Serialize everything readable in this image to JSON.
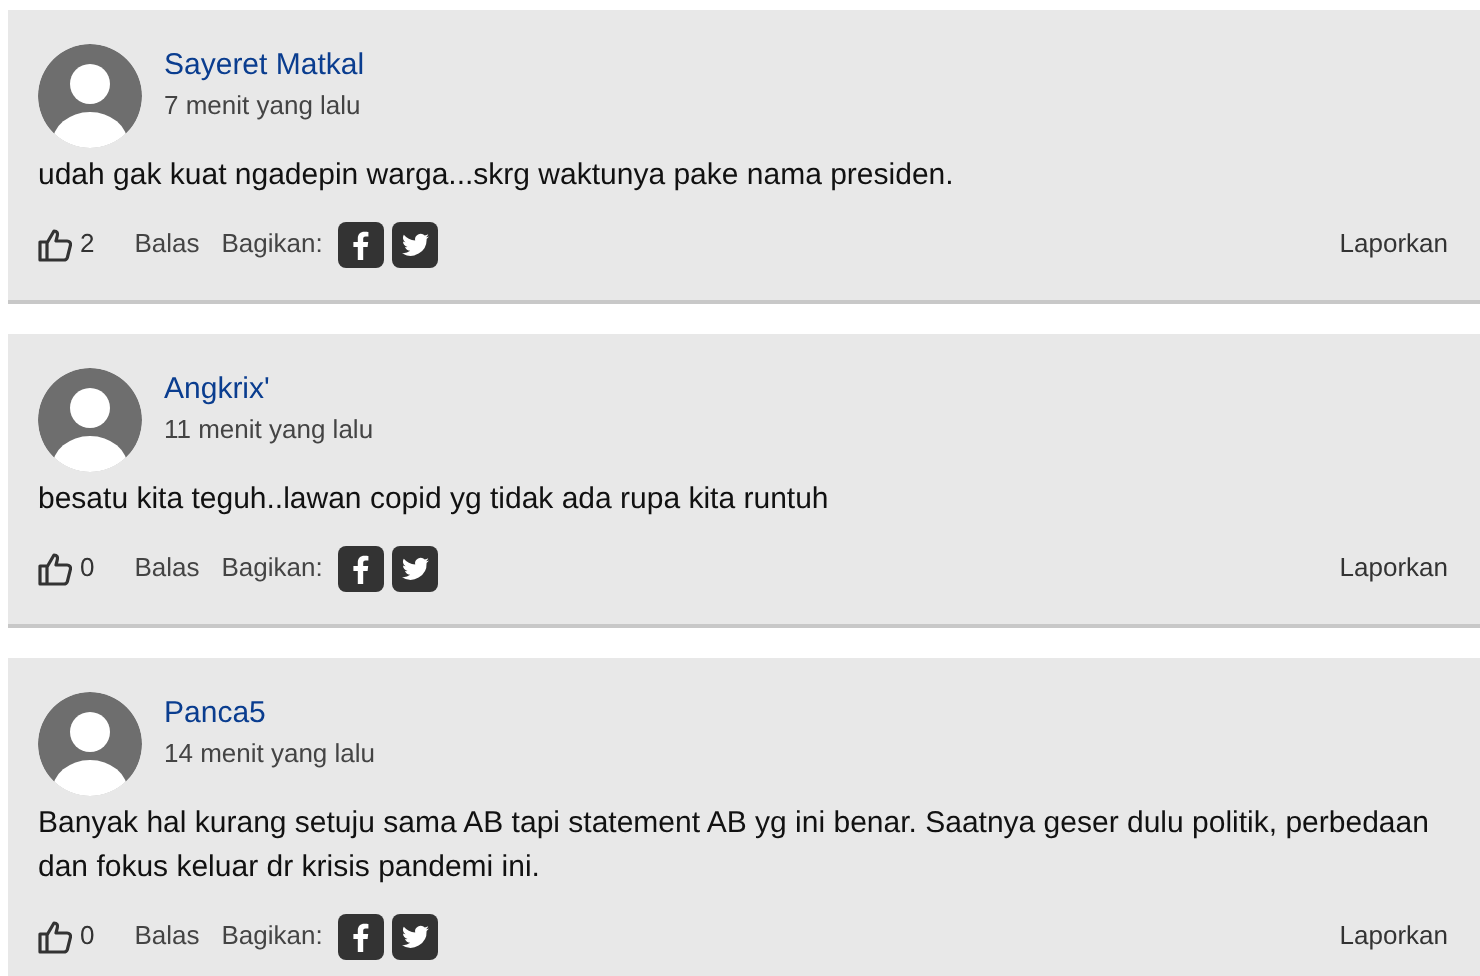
{
  "comments": [
    {
      "author": "Sayeret Matkal",
      "time": "7 menit yang lalu",
      "text": "udah gak kuat ngadepin warga...skrg waktunya pake nama presiden.",
      "likes": "2",
      "reply": "Balas",
      "share_label": "Bagikan:",
      "report": "Laporkan"
    },
    {
      "author": "Angkrix'",
      "time": "11 menit yang lalu",
      "text": "besatu kita teguh..lawan copid yg tidak ada rupa kita runtuh",
      "likes": "0",
      "reply": "Balas",
      "share_label": "Bagikan:",
      "report": "Laporkan"
    },
    {
      "author": "Panca5",
      "time": "14 menit yang lalu",
      "text": "Banyak hal kurang setuju sama AB tapi statement AB yg ini benar. Saatnya geser dulu politik, perbedaan dan fokus keluar dr krisis pandemi ini.",
      "likes": "0",
      "reply": "Balas",
      "share_label": "Bagikan:",
      "report": "Laporkan"
    }
  ]
}
